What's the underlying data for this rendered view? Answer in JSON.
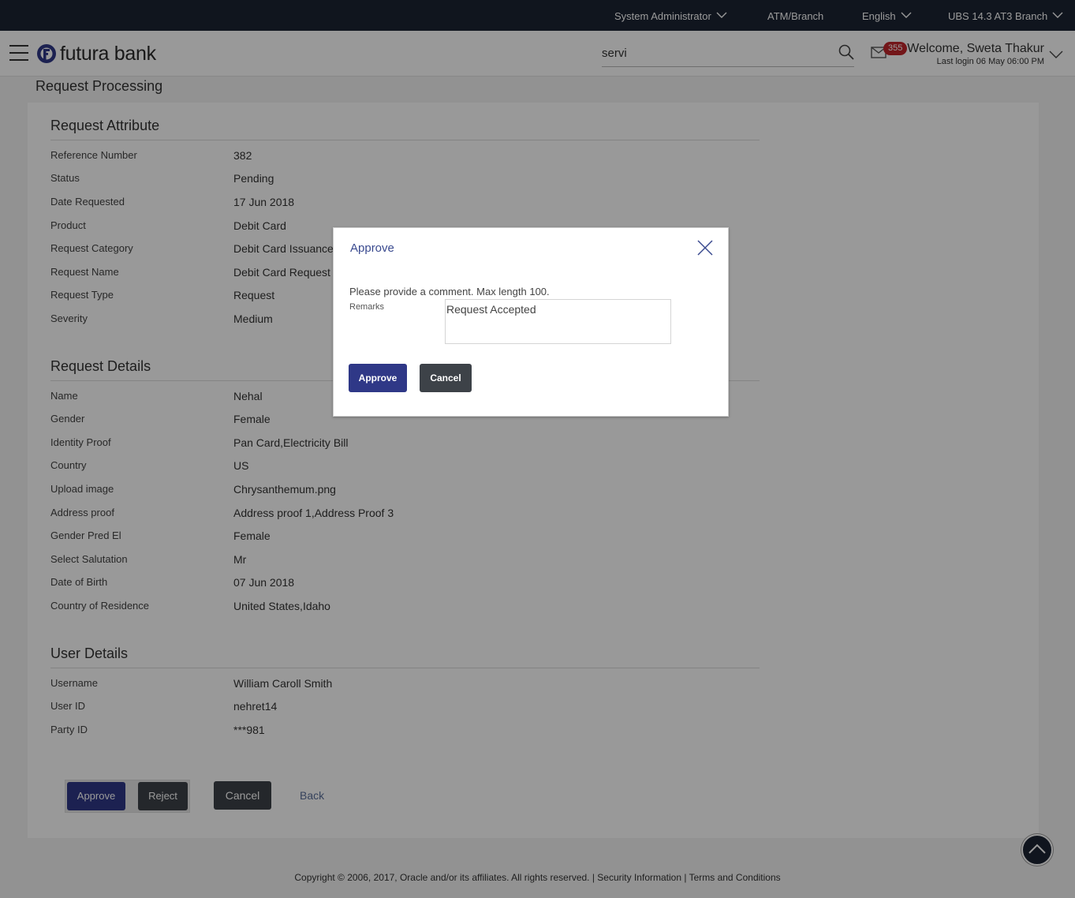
{
  "topbar": {
    "role": "System Administrator",
    "atm_branch": "ATM/Branch",
    "language": "English",
    "branch": "UBS 14.3 AT3 Branch"
  },
  "header": {
    "logo_text": "futura bank",
    "search_value": "servi",
    "mail_count": "355",
    "welcome": "Welcome, Sweta Thakur",
    "last_login": "Last login 06 May 06:00 PM"
  },
  "page": {
    "title": "Request Processing"
  },
  "request_attribute": {
    "title": "Request Attribute",
    "rows": [
      {
        "label": "Reference Number",
        "value": "382"
      },
      {
        "label": "Status",
        "value": "Pending"
      },
      {
        "label": "Date Requested",
        "value": "17 Jun 2018"
      },
      {
        "label": "Product",
        "value": "Debit Card"
      },
      {
        "label": "Request Category",
        "value": "Debit Card Issuance"
      },
      {
        "label": "Request Name",
        "value": "Debit Card Request"
      },
      {
        "label": "Request Type",
        "value": "Request"
      },
      {
        "label": "Severity",
        "value": "Medium"
      }
    ]
  },
  "request_details": {
    "title": "Request Details",
    "rows": [
      {
        "label": "Name",
        "value": "Nehal"
      },
      {
        "label": "Gender",
        "value": "Female"
      },
      {
        "label": "Identity Proof",
        "value": "Pan Card,Electricity Bill"
      },
      {
        "label": "Country",
        "value": "US"
      },
      {
        "label": "Upload image",
        "value": "Chrysanthemum.png"
      },
      {
        "label": "Address proof",
        "value": "Address proof 1,Address Proof 3"
      },
      {
        "label": "Gender Pred El",
        "value": "Female"
      },
      {
        "label": "Select Salutation",
        "value": "Mr"
      },
      {
        "label": "Date of Birth",
        "value": "07 Jun 2018"
      },
      {
        "label": "Country of Residence",
        "value": "United States,Idaho"
      }
    ]
  },
  "user_details": {
    "title": "User Details",
    "rows": [
      {
        "label": "Username",
        "value": "William Caroll Smith"
      },
      {
        "label": "User ID",
        "value": "nehret14"
      },
      {
        "label": "Party ID",
        "value": "***981"
      }
    ]
  },
  "actions": {
    "approve": "Approve",
    "reject": "Reject",
    "cancel": "Cancel",
    "back": "Back"
  },
  "footer": {
    "text": "Copyright © 2006, 2017, Oracle and/or its affiliates. All rights reserved. | Security Information | Terms and Conditions"
  },
  "modal": {
    "title": "Approve",
    "message": "Please provide a comment. Max length 100.",
    "remarks_label": "Remarks",
    "remarks_value": "Request Accepted",
    "approve": "Approve",
    "cancel": "Cancel"
  },
  "icons": {
    "menu": "hamburger-menu-icon",
    "search": "search-icon",
    "mail": "mail-icon",
    "chevron": "chevron-down-icon",
    "close": "close-icon",
    "scroll_top": "chevron-up-icon"
  },
  "colors": {
    "topbar": "#1c2433",
    "primary_button": "#2f3887",
    "dark_button": "#3d4248",
    "badge": "#c0252a",
    "modal_title": "#3a4a8f"
  }
}
